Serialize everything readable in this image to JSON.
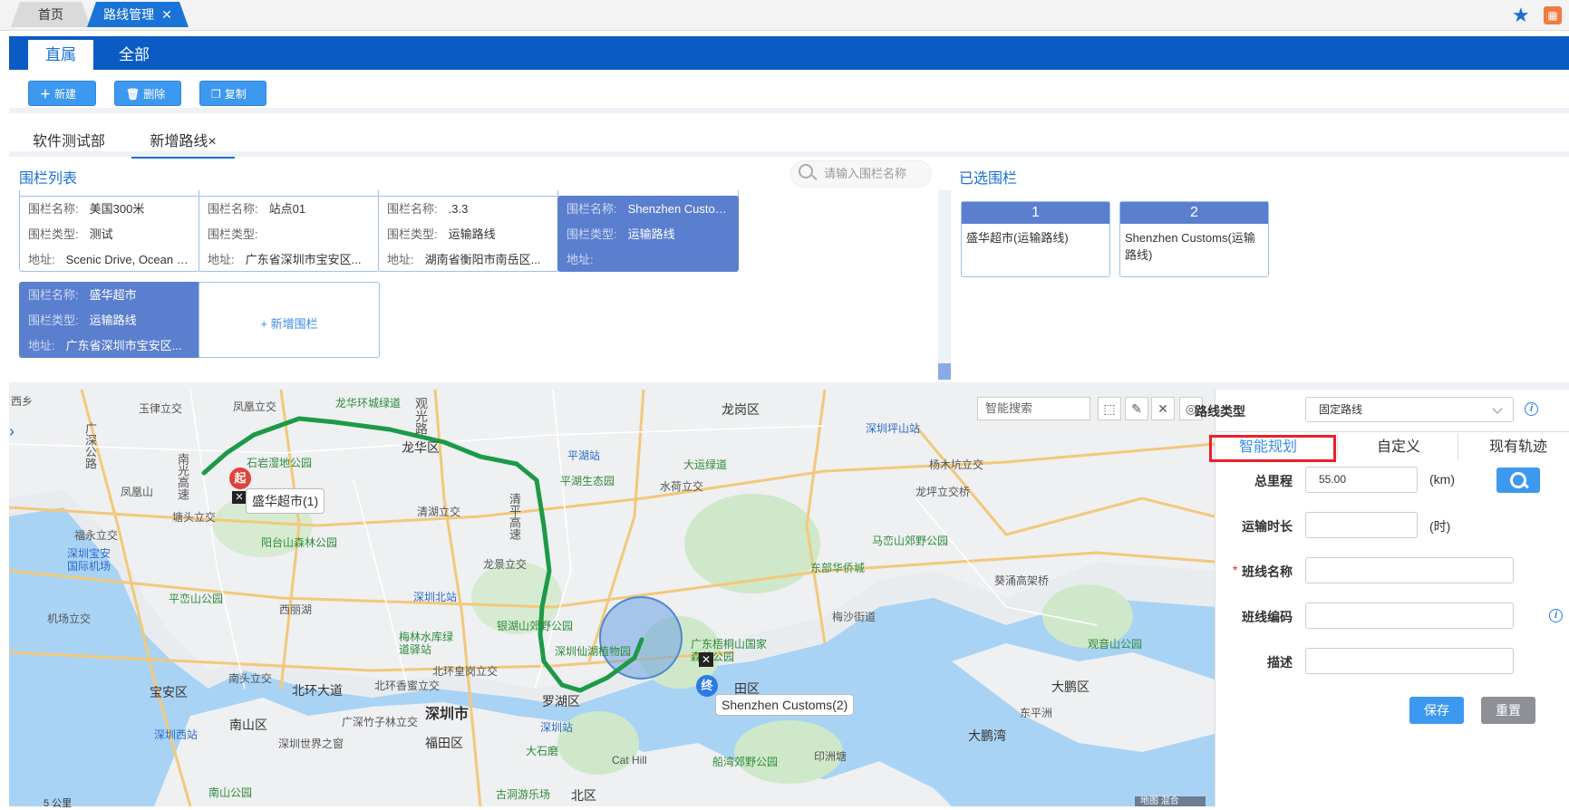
{
  "top_tabs": [
    {
      "label": "首页"
    },
    {
      "label": "路线管理",
      "close": "✕"
    }
  ],
  "header_tabs": {
    "direct": "直属",
    "all": "全部"
  },
  "toolbar": {
    "new_label": "新建",
    "delete_label": "删除",
    "copy_label": "复制"
  },
  "sub_tabs": {
    "dept": "软件测试部",
    "new_route": "新增路线×"
  },
  "fence_list": {
    "title": "围栏列表",
    "search_placeholder": "请输入围栏名称",
    "labels": {
      "name": "围栏名称:",
      "type": "围栏类型:",
      "address": "地址:"
    },
    "cards": [
      {
        "name": "美国300米",
        "type": "测试",
        "address": "Scenic Drive, Ocean Beach...",
        "selected": false
      },
      {
        "name": "站点01",
        "type": "",
        "address": "广东省深圳市宝安区...",
        "selected": false
      },
      {
        "name": ".3.3",
        "type": "运输路线",
        "address": "湖南省衡阳市南岳区...",
        "selected": false
      },
      {
        "name": "Shenzhen Customs",
        "type": "运输路线",
        "address": "",
        "selected": true
      },
      {
        "name": "盛华超市",
        "type": "运输路线",
        "address": "广东省深圳市宝安区...",
        "selected": true
      }
    ],
    "add_label": "+ 新增围栏"
  },
  "selected_fences": {
    "title": "已选围栏",
    "items": [
      {
        "index": "1",
        "name": "盛华超市(运输路线)"
      },
      {
        "index": "2",
        "name": "Shenzhen Customs(运输路线)"
      }
    ]
  },
  "map": {
    "search_placeholder": "智能搜索",
    "start_marker": "起",
    "end_marker": "终",
    "start_label": "盛华超市(1)",
    "end_label": "Shenzhen Customs(2)",
    "scale": "5 公里",
    "map_type": "地图  混合",
    "places": {
      "yuanxi": "西乡",
      "yulv": "玉律立交",
      "fengling": "凤凰立交",
      "longhua_ring": "龙华环城绿道",
      "guanlan": "观光路",
      "longgang": "龙岗区",
      "shenzhen_pingshan": "深圳坪山站",
      "guangshen": "广深公路",
      "nanguang": "南光高速",
      "shiyan": "石岩湿地公园",
      "longhua": "龙华区",
      "pingshan_stn": "平湖站",
      "dayun": "大运绿道",
      "yangmu": "杨木坑立交",
      "longping": "龙坪立交桥",
      "fenghuang": "凤凰山",
      "tangtou": "塘头立交",
      "qinghu": "清湖立交",
      "qingping": "清平高速",
      "pinghu_eco": "平湖生态园",
      "shuihe": "水荷立交",
      "yangtai": "阳台山森林公园",
      "maluan": "马峦山郊野公园",
      "hengyong": "福永立交",
      "airport": "深圳宝安国际机场",
      "longjing": "龙景立交",
      "east_hq": "东部华侨城",
      "kuichong": "葵涌高架桥",
      "pingmao": "平峦山公园",
      "xili_lake": "西丽湖",
      "shenzhen_north": "深圳北站",
      "airport_interchange": "机场立交",
      "meilin": "梅林水库绿道驿站",
      "yinhu": "银湖山郊野公园",
      "botanic": "深圳仙湖植物园",
      "wutong": "广东梧桐山国家森林公园",
      "meisha": "梅沙街道",
      "guanyin": "观音山公园",
      "nantou": "南头立交",
      "beihuan": "北环大道",
      "beida": "北环皇岗立交",
      "xiangmi": "北环香蜜立交",
      "baoan": "宝安区",
      "luohu": "罗湖区",
      "futian_e": "田区",
      "dapeng": "大鹏区",
      "dongchong": "东平洲",
      "dapengwan": "大鹏湾",
      "szcity": "深圳市",
      "guangshen_bamboo": "广深竹子林立交",
      "nanshan": "南山区",
      "shenzhen_west": "深圳西站",
      "window": "深圳世界之窗",
      "futian": "福田区",
      "shenzhen_stn": "深圳站",
      "dashishan": "大石磨",
      "cathill": "Cat Hill",
      "chuanwan": "船湾郊野公园",
      "yinzhou": "印洲塘",
      "nanshan_park": "南山公园",
      "gudong": "古洞游乐场",
      "beiqu": "北区"
    }
  },
  "form": {
    "route_type_label": "路线类型",
    "route_type_value": "固定路线",
    "tabs": {
      "smart": "智能规划",
      "custom": "自定义",
      "track": "现有轨迹"
    },
    "total_mileage_label": "总里程",
    "total_mileage_value": "55.00",
    "mileage_unit": "(km)",
    "duration_label": "运输时长",
    "duration_value": "",
    "duration_unit": "(时)",
    "required_mark": "*",
    "line_name_label": "班线名称",
    "line_name_value": "",
    "line_code_label": "班线编码",
    "line_code_value": "",
    "desc_label": "描述",
    "desc_value": "",
    "save_label": "保存",
    "reset_label": "重置",
    "info_icon": "i"
  },
  "colors": {
    "primary": "#0a5bc4",
    "accent": "#3d98f0",
    "selected_card": "#5b7fcf",
    "route": "#1c9a48",
    "highlight": "#e8212b"
  }
}
